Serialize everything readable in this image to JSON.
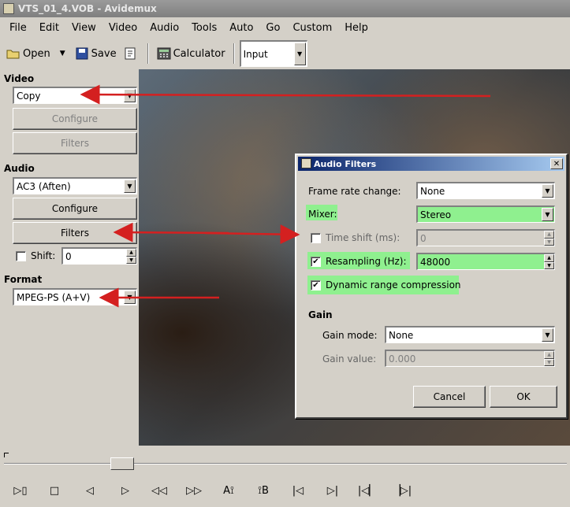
{
  "window": {
    "title": "VTS_01_4.VOB - Avidemux"
  },
  "menu": [
    "File",
    "Edit",
    "View",
    "Video",
    "Audio",
    "Tools",
    "Auto",
    "Go",
    "Custom",
    "Help"
  ],
  "toolbar": {
    "open_label": "Open",
    "save_label": "Save",
    "calculator_label": "Calculator",
    "view_mode": "Input"
  },
  "video": {
    "section": "Video",
    "codec": "Copy",
    "configure": "Configure",
    "filters": "Filters"
  },
  "audio": {
    "section": "Audio",
    "codec": "AC3 (Aften)",
    "configure": "Configure",
    "filters": "Filters",
    "shift_label": "Shift:",
    "shift_value": "0"
  },
  "format": {
    "section": "Format",
    "container": "MPEG-PS (A+V)"
  },
  "dialog": {
    "title": "Audio Filters",
    "frame_rate_label": "Frame rate change:",
    "frame_rate_value": "None",
    "mixer_label": "Mixer:",
    "mixer_value": "Stereo",
    "time_shift_label": "Time shift (ms):",
    "time_shift_value": "0",
    "resampling_label": "Resampling (Hz):",
    "resampling_value": "48000",
    "drc_label": "Dynamic range compression",
    "gain_section": "Gain",
    "gain_mode_label": "Gain mode:",
    "gain_mode_value": "None",
    "gain_value_label": "Gain value:",
    "gain_value_value": "0.000",
    "cancel": "Cancel",
    "ok": "OK",
    "time_shift_checked": false,
    "resampling_checked": true,
    "drc_checked": true
  },
  "colors": {
    "highlight": "#8ff08f",
    "arrow": "#d42020"
  }
}
